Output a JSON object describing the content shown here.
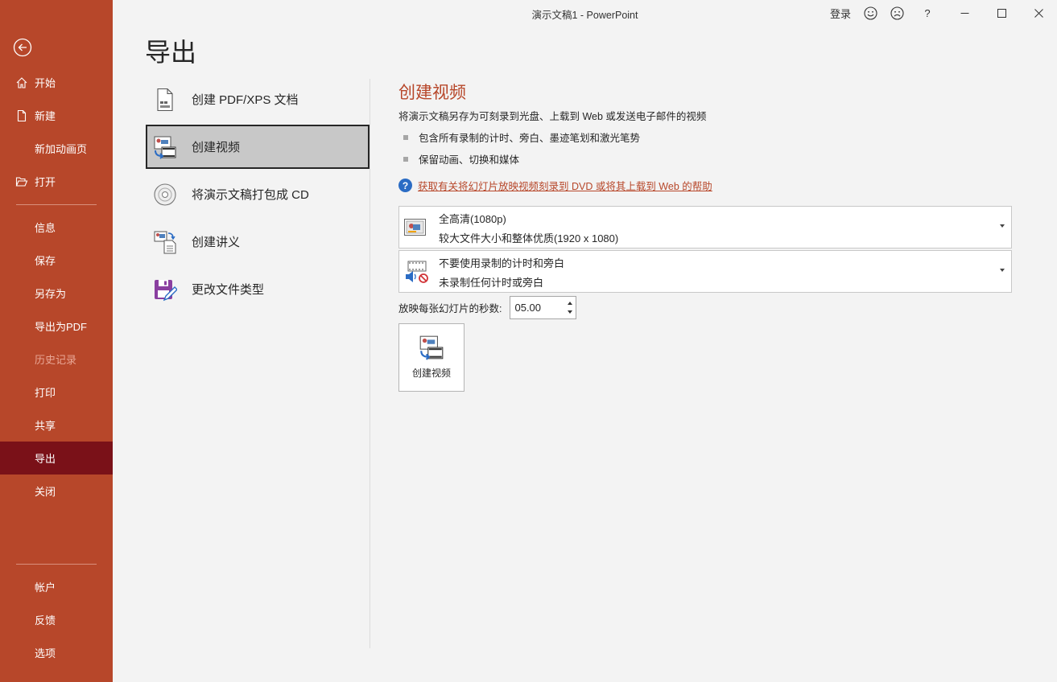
{
  "window": {
    "title": "演示文稿1  -  PowerPoint",
    "signin": "登录",
    "help": "?"
  },
  "sidebar": {
    "items": [
      {
        "label": "开始"
      },
      {
        "label": "新建"
      },
      {
        "label": "新加动画页"
      },
      {
        "label": "打开"
      },
      {
        "label": "信息"
      },
      {
        "label": "保存"
      },
      {
        "label": "另存为"
      },
      {
        "label": "导出为PDF"
      },
      {
        "label": "历史记录"
      },
      {
        "label": "打印"
      },
      {
        "label": "共享"
      },
      {
        "label": "导出"
      },
      {
        "label": "关闭"
      },
      {
        "label": "帐户"
      },
      {
        "label": "反馈"
      },
      {
        "label": "选项"
      }
    ]
  },
  "page": {
    "title": "导出"
  },
  "export_options": [
    {
      "label": "创建 PDF/XPS 文档",
      "icon": "pdf-document-icon"
    },
    {
      "label": "创建视频",
      "icon": "create-video-icon"
    },
    {
      "label": "将演示文稿打包成 CD",
      "icon": "cd-icon"
    },
    {
      "label": "创建讲义",
      "icon": "handout-icon"
    },
    {
      "label": "更改文件类型",
      "icon": "change-file-type-icon"
    }
  ],
  "panel": {
    "title": "创建视频",
    "description": "将演示文稿另存为可刻录到光盘、上载到 Web 或发送电子邮件的视频",
    "bullets": [
      "包含所有录制的计时、旁白、墨迹笔划和激光笔势",
      "保留动画、切换和媒体"
    ],
    "help_link": "获取有关将幻灯片放映视频刻录到 DVD 或将其上载到 Web 的帮助",
    "quality_dropdown": {
      "line1": "全高清(1080p)",
      "line2": "较大文件大小和整体优质(1920 x 1080)"
    },
    "timing_dropdown": {
      "line1": "不要使用录制的计时和旁白",
      "line2": "未录制任何计时或旁白"
    },
    "seconds_label": "放映每张幻灯片的秒数:",
    "seconds_value": "05.00",
    "create_button": "创建视频"
  },
  "colors": {
    "accent": "#b7472a",
    "sidebar_active": "#7a1118",
    "background": "#f3f3f3"
  }
}
